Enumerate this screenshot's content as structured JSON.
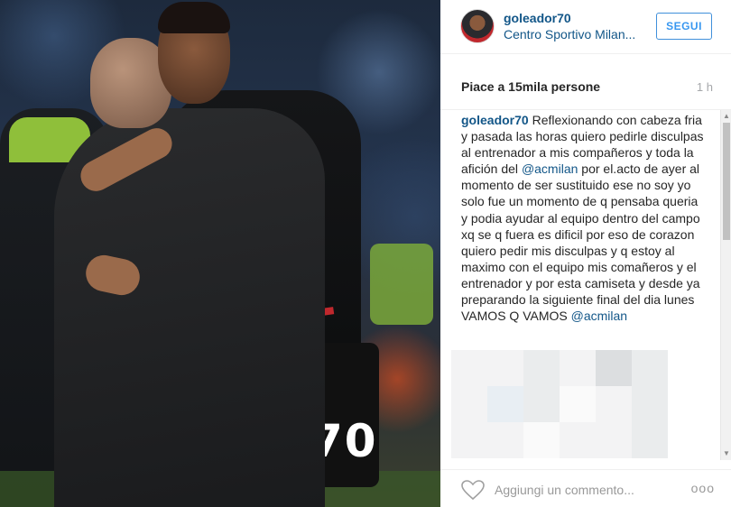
{
  "photo": {
    "jersey_number": "70"
  },
  "header": {
    "username": "goleador70",
    "location": "Centro Sportivo Milan...",
    "follow_label": "SEGUI"
  },
  "stats": {
    "likes": "Piace a 15mila persone",
    "time": "1 h"
  },
  "caption": {
    "user": "goleador70",
    "part1": " Reflexionando con cabeza fria y pasada las horas quiero pedirle disculpas al entrenador a mis compañeros y toda la afición del ",
    "mention1": "@acmilan",
    "part2": " por el.acto de ayer al momento de ser sustituido ese no soy yo solo fue un momento de q pensaba queria y podia ayudar al equipo dentro del campo xq se q fuera es dificil por eso de corazon quiero pedir mis disculpas y q estoy al maximo con el equipo mis comañeros y el entrenador y por esta camiseta y desde ya preparando la siguiente final del dia lunes VAMOS Q VAMOS ",
    "mention2": "@acmilan"
  },
  "footer": {
    "comment_placeholder": "Aggiungi un commento...",
    "more_label": "ooo"
  },
  "icons": {
    "like": "heart-icon",
    "more": "more-options-icon",
    "scroll_up": "scroll-up-arrow-icon",
    "scroll_down": "scroll-down-arrow-icon"
  },
  "colors": {
    "link": "#125688",
    "follow_button": "#3897f0",
    "muted": "#999999"
  }
}
